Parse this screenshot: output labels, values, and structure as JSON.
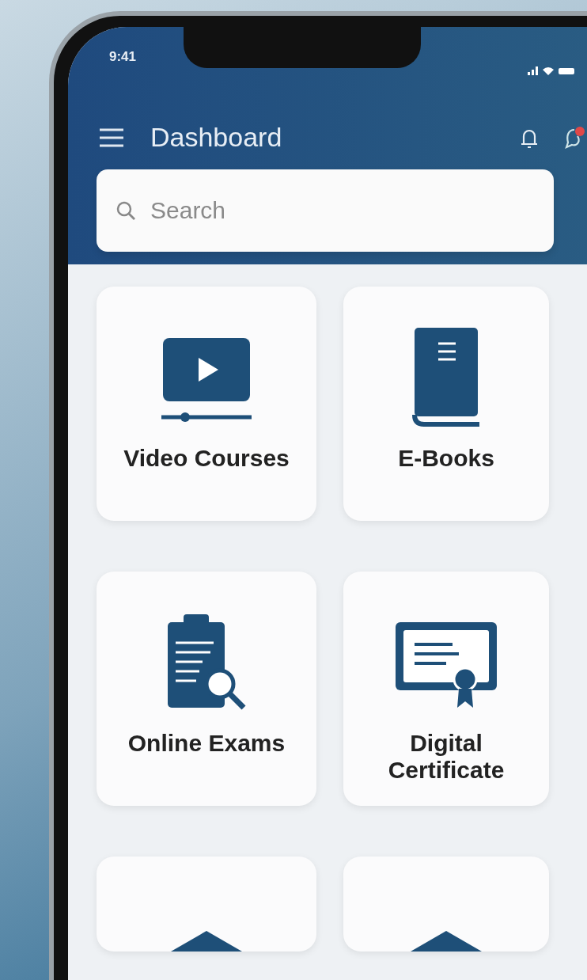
{
  "status_bar": {
    "time": "9:41"
  },
  "header": {
    "title": "Dashboard",
    "actions": [
      {
        "kind": "bell",
        "badge": false
      },
      {
        "kind": "chat",
        "badge": true
      }
    ]
  },
  "search": {
    "placeholder": "Search"
  },
  "tiles": [
    {
      "kind": "video",
      "label": "Video Courses"
    },
    {
      "kind": "book",
      "label": "E-Books"
    },
    {
      "kind": "exam",
      "label": "Online Exams"
    },
    {
      "kind": "certificate",
      "label": "Digital Certificate"
    },
    {
      "kind": "partial"
    },
    {
      "kind": "partial"
    }
  ]
}
